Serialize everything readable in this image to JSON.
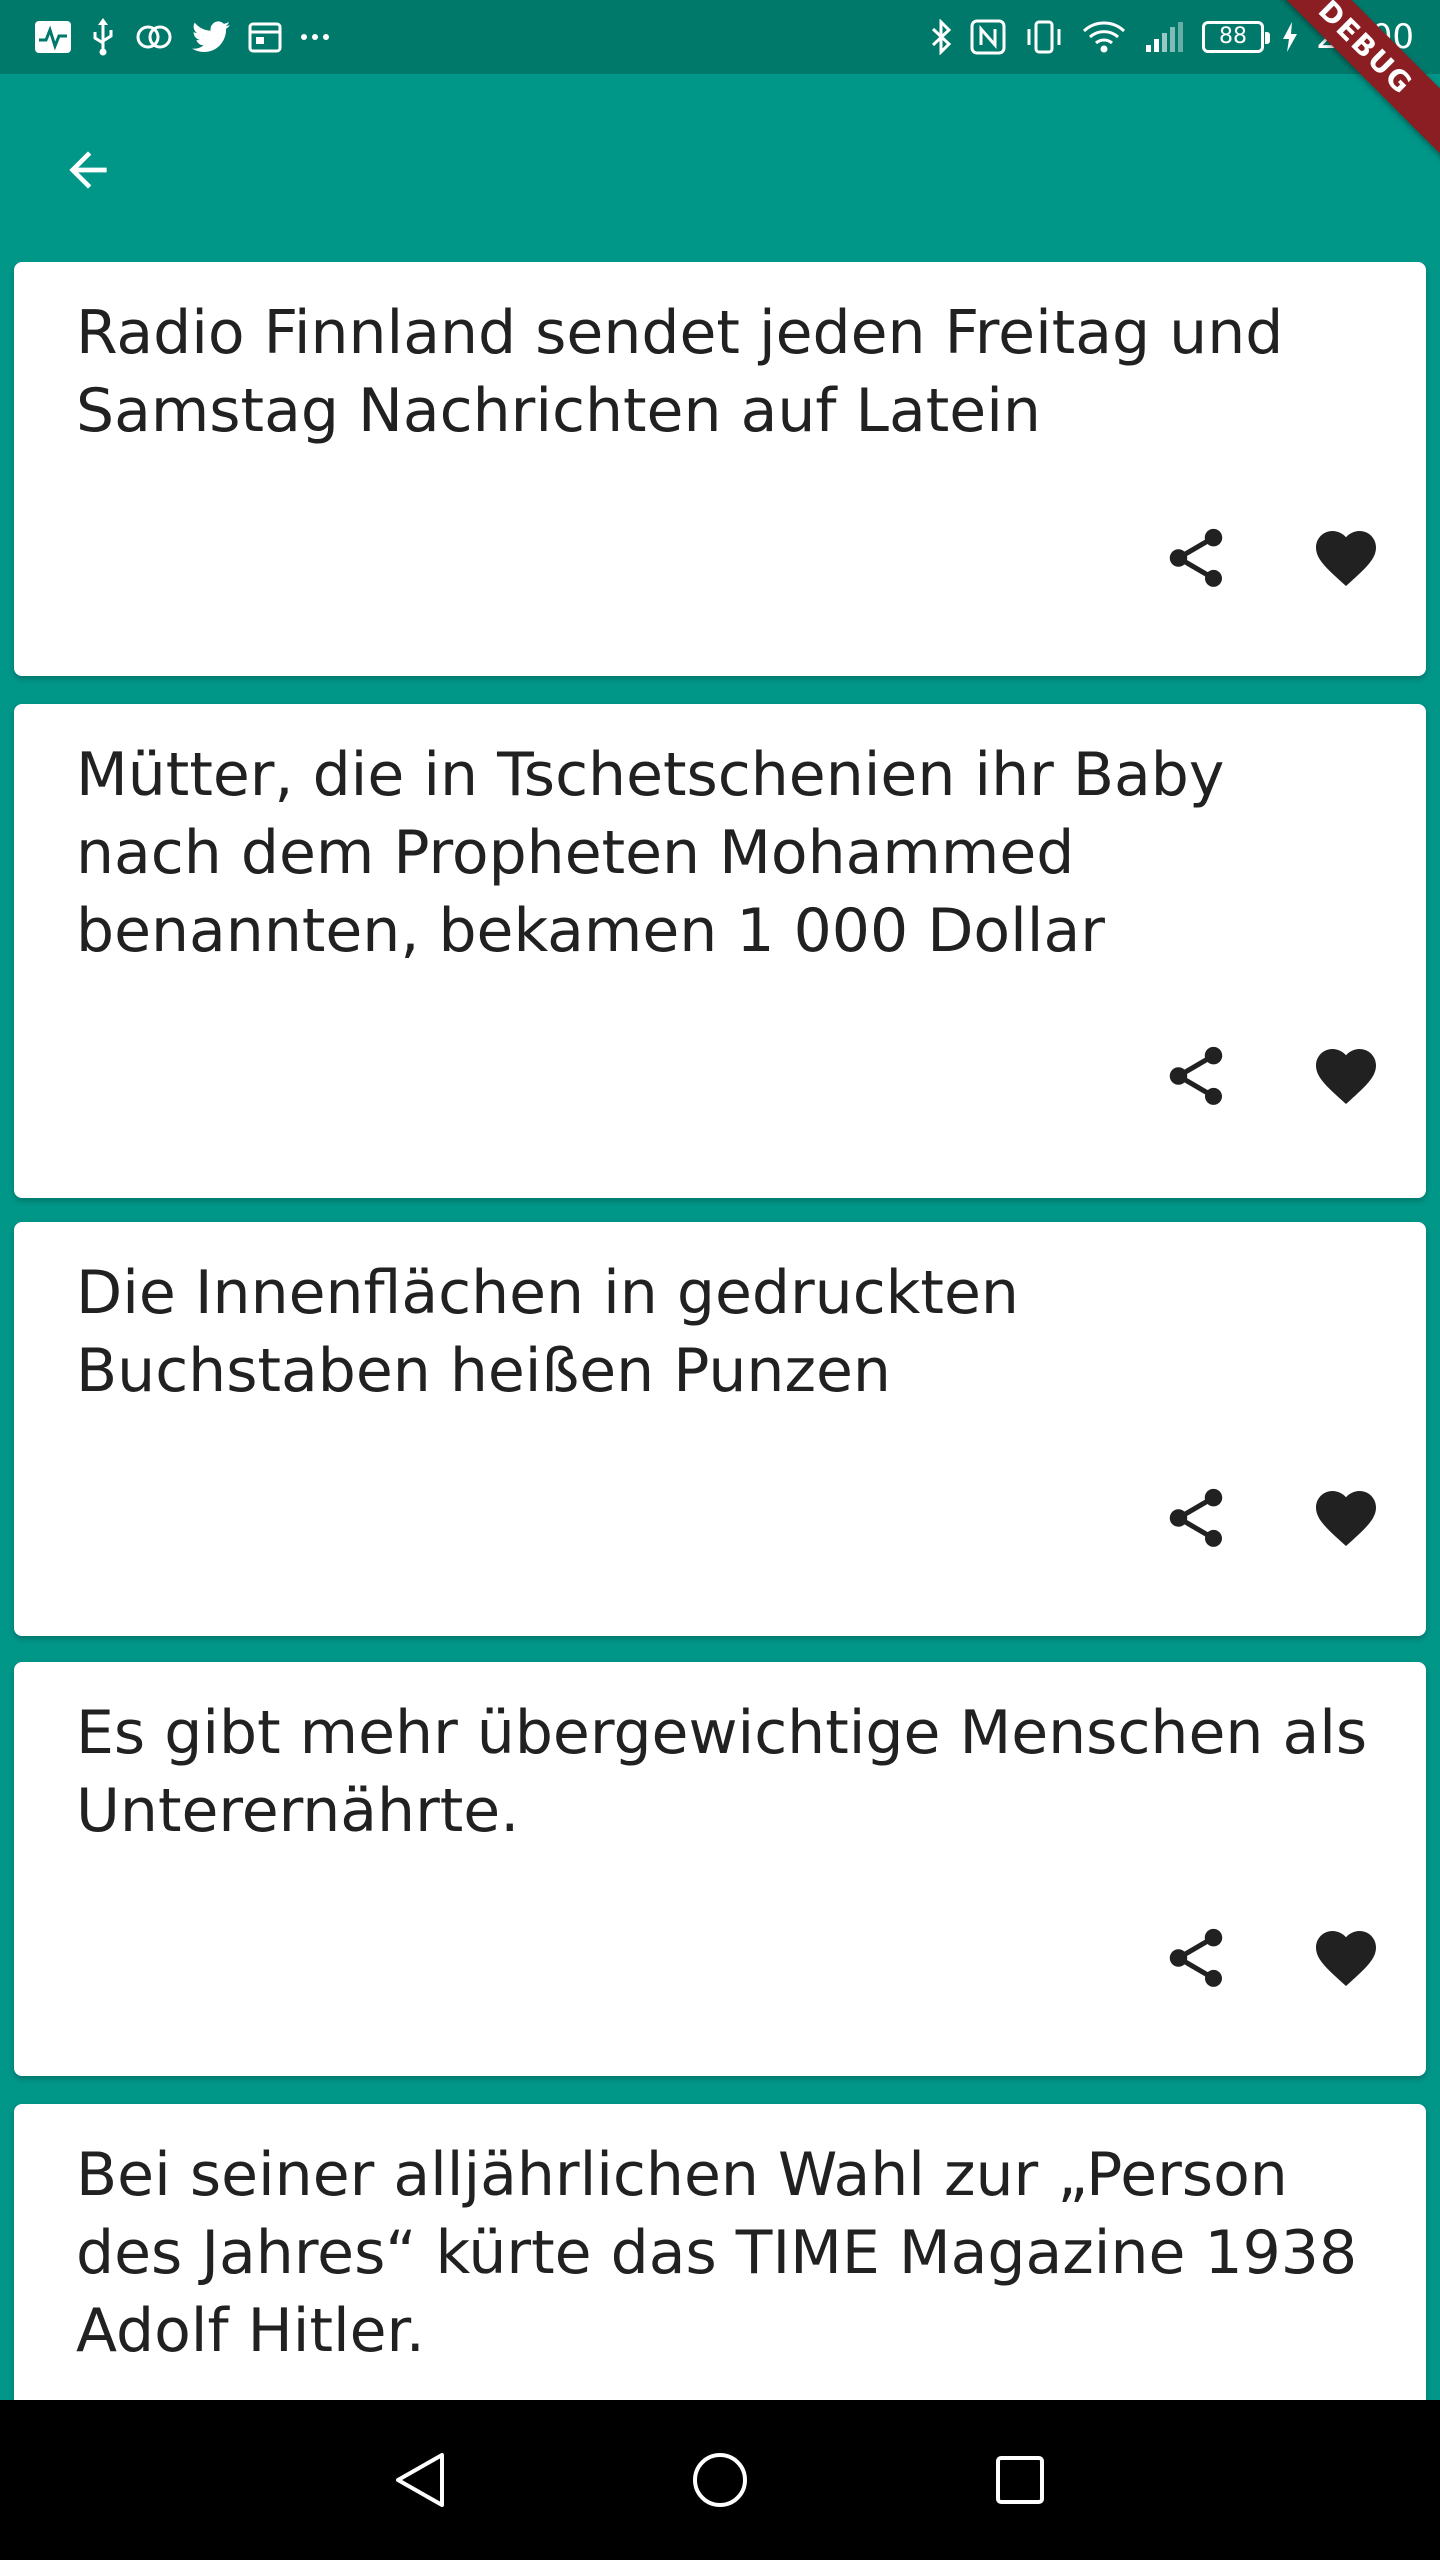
{
  "status_bar": {
    "time": "20:00",
    "battery_level": "88",
    "left_icons": [
      "activity-icon",
      "usb-icon",
      "cast-icon",
      "twitter-icon",
      "calendar-icon",
      "more-icon"
    ],
    "right_icons": [
      "bluetooth-icon",
      "nfc-icon",
      "vibrate-icon",
      "wifi-icon",
      "signal-icon",
      "battery-icon",
      "charging-icon"
    ]
  },
  "debug_banner": {
    "label": "DEBUG"
  },
  "app_bar": {
    "back_icon": "arrow-back-icon"
  },
  "facts": [
    {
      "text": "Radio Finnland sendet jeden Freitag und Samstag Nachrichten auf Latein"
    },
    {
      "text": "Mütter, die in Tschetschenien ihr Baby nach dem Propheten Mohammed benannten, bekamen 1 000 Dollar"
    },
    {
      "text": "Die Innenflächen in gedruckten Buchstaben heißen Punzen"
    },
    {
      "text": "Es gibt mehr übergewichtige Menschen als Unterernährte."
    },
    {
      "text": "Bei seiner alljährlichen Wahl zur „Person des Jahres“ kürte das TIME Magazine 1938 Adolf Hitler."
    }
  ],
  "card_actions": {
    "share_icon": "share-icon",
    "like_icon": "heart-icon"
  },
  "nav_bar": {
    "back": "triangle-back-icon",
    "home": "circle-home-icon",
    "recents": "square-recents-icon"
  },
  "colors": {
    "primary": "#009688",
    "status_bar": "#00796B",
    "card": "#ffffff",
    "text": "#212121",
    "debug": "#8B1E22"
  }
}
